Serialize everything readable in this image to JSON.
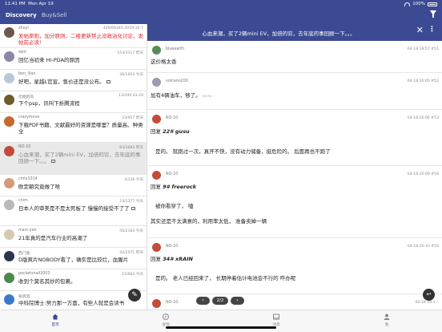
{
  "status_bar": {
    "time": "11:41 PM",
    "date": "Mon Apr 19",
    "battery": "100%"
  },
  "nav": {
    "tabs": [
      "Discovery",
      "Buy&Sell"
    ]
  },
  "thread_header": {
    "title": "心血来潮，买了2辆mini EV，加倍的穷，去年底的事回顾一下。。。"
  },
  "threads": [
    {
      "author": "zhuyi",
      "meta": "449/66340   2019-10-7",
      "title": "发帖原则，加分原则，二楼更新禁止没政治化讨论，发帖前必读!",
      "red": true,
      "avatar_color": "#6b5a4a"
    },
    {
      "author": "wjnt",
      "meta": "153/3317   昨天",
      "title": "回忆当初来 HI-PDA的原因",
      "avatar_color": "#8a86a8"
    },
    {
      "author": "ben_lilan",
      "meta": "36/1603   今天",
      "title": "好吧，星越L官宣，售价还是没公布。",
      "avatar_color": "#b9c7d8"
    },
    {
      "author": "迁徙的鸟",
      "meta": "13/449   03-29",
      "title": "下个psp，讯叫下折腾流程",
      "avatar_color": "#6f5c2d"
    },
    {
      "author": "crazymove",
      "meta": "23/957   昨天",
      "title": "下载PDF书籍、文献最好的资源是哪里？质量高、种类全",
      "avatar_color": "#c56a2a"
    },
    {
      "author": "NO-10",
      "meta": "83/3883   昨天",
      "title": "心血来潮，买了2辆mini EV，加倍的穷，去年底的事回顾一下。。。",
      "avatar_color": "#c24b3a",
      "selected": true
    },
    {
      "author": "cmlx1014",
      "meta": "3/136   今天",
      "title": "欧定朝究竟做了啥",
      "avatar_color": "#d49a7a"
    },
    {
      "author": "chim",
      "meta": "23/1377   今天",
      "title": "日本人的审美是不是太死板了 慢慢的接受不了了",
      "avatar_color": "#b9b9b9"
    },
    {
      "author": "marc-yen",
      "meta": "56/2183   今天",
      "title": "21年真的是汽车行业的高潮了",
      "avatar_color": "#d6c9b0"
    },
    {
      "author": "西门金",
      "meta": "42/2071   昨天",
      "title": "D版爽片NOBODY看了，确实是比较烂，血腥片",
      "avatar_color": "#2a3550"
    },
    {
      "author": "pocketsnail2003",
      "meta": "15/664   今天",
      "title": "收到个莫名其妙的包裹。",
      "avatar_color": "#4a8a4a"
    },
    {
      "author": "张浪浪",
      "meta": "30/15...",
      "title": "中科院博士:努力那一方面，有些人就是会读书",
      "avatar_color": "#3a7ac8"
    }
  ],
  "posts": [
    {
      "author": "blueearth",
      "meta": "04-18 19:57   #51",
      "body": "这价格太香",
      "avatar_color": "#5a8a5a"
    },
    {
      "author": "volcano200",
      "meta": "04-18 20:05   #52",
      "body": "加有4辆油车，够了。",
      "tiny": "iOS fly ~",
      "avatar_color": "#9a9ab0"
    },
    {
      "author": "NO-10",
      "meta": "04-18 20:06   #53",
      "reply_prefix": "回复",
      "quote": "22# gusu",
      "body": "是的。 就跑过一次，真开不快，没有动力储备，挺危险的。   后面再也不跑了",
      "avatar_color": "#c24b3a"
    },
    {
      "author": "NO-10",
      "meta": "04-18 20:09   #54",
      "reply_prefix": "回复",
      "quote": "9# freerock",
      "body": "被你看穿了， 嗑",
      "body2": "其实还是不太满意的，利用率太低， 准备卖掉一辆",
      "avatar_color": "#c24b3a"
    },
    {
      "author": "NO-10",
      "meta": "04-18 20:10   #55",
      "reply_prefix": "回复",
      "quote": "34# xRAIN",
      "body": "是的。 老人已经回来了， 长期停着估计电池会不行的         咋办呢",
      "avatar_color": "#c24b3a"
    },
    {
      "author": "NO-10",
      "meta": "04-18 20:1...",
      "body": "",
      "avatar_color": "#c24b3a"
    }
  ],
  "pager": {
    "prev": "‹",
    "current": "2/2",
    "next": "›"
  },
  "tabbar": {
    "items": [
      "首页",
      "发现",
      "消息",
      "我"
    ]
  }
}
